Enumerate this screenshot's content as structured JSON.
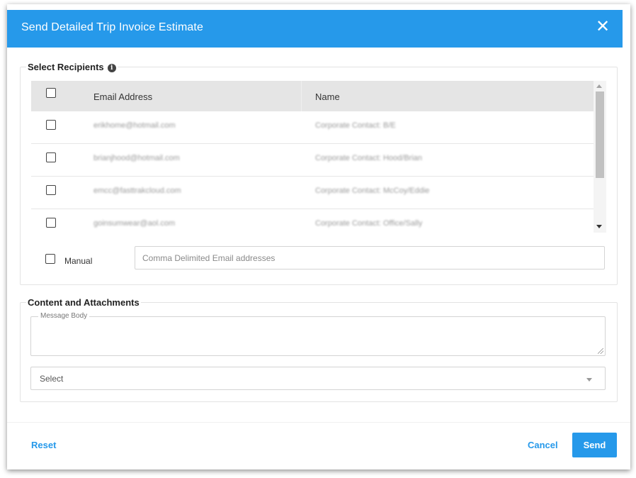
{
  "dialog": {
    "title": "Send Detailed Trip Invoice Estimate",
    "close_icon": "close-icon"
  },
  "recipients": {
    "legend": "Select Recipients",
    "info_icon": "info-icon",
    "columns": [
      "Email Address",
      "Name"
    ],
    "rows": [
      {
        "email": "erikhome@hotmail.com",
        "name": "Corporate Contact: B/E"
      },
      {
        "email": "brianjhood@hotmail.com",
        "name": "Corporate Contact: Hood/Brian"
      },
      {
        "email": "emcc@fasttrakcloud.com",
        "name": "Corporate Contact: McCoy/Eddie"
      },
      {
        "email": "goinsumwear@aol.com",
        "name": "Corporate Contact: Office/Sally"
      }
    ],
    "manual_label": "Manual",
    "manual_placeholder": "Comma Delimited Email addresses"
  },
  "content": {
    "legend": "Content and Attachments",
    "message_label": "Message Body",
    "select_value": "Select"
  },
  "footer": {
    "reset": "Reset",
    "cancel": "Cancel",
    "send": "Send"
  },
  "colors": {
    "accent": "#2699ea",
    "header_bg": "#e5e5e5"
  }
}
